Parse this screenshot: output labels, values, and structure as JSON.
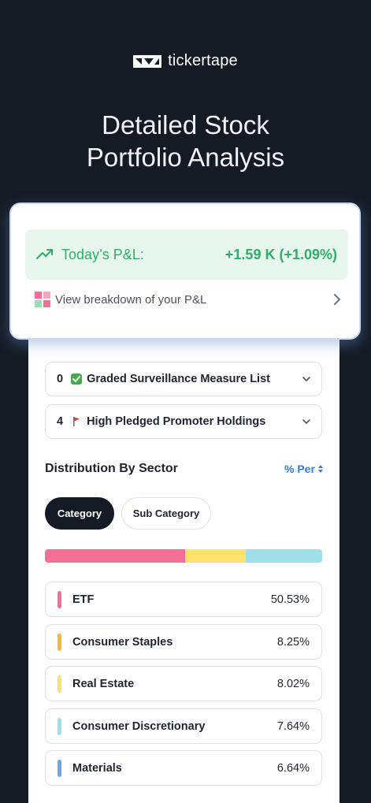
{
  "brand": {
    "name": "tickertape"
  },
  "hero": {
    "line1": "Detailed Stock",
    "line2": "Portfolio Analysis"
  },
  "pnl": {
    "label": "Today’s P&L:",
    "value": "+1.59 K (+1.09%)",
    "breakdown_label": "View breakdown of your P&L"
  },
  "alerts": [
    {
      "count": "0",
      "emoji": "check-mark-icon",
      "label": "Graded Surveillance Measure List"
    },
    {
      "count": "4",
      "emoji": "red-flag-icon",
      "label": "High Pledged Promoter Holdings"
    }
  ],
  "distribution": {
    "title": "Distribution By Sector",
    "toggle_label": "% Per",
    "tabs": [
      "Category",
      "Sub Category"
    ],
    "bar_segments": [
      {
        "share": 50.53,
        "color": "#f36f93"
      },
      {
        "share": 21.9,
        "color": "#fde36b"
      },
      {
        "share": 27.57,
        "color": "#9ee0ea"
      }
    ],
    "sectors": [
      {
        "name": "ETF",
        "pct": "50.53%",
        "color": "#f36f93"
      },
      {
        "name": "Consumer Staples",
        "pct": "8.25%",
        "color": "#f5b93a"
      },
      {
        "name": "Real Estate",
        "pct": "8.02%",
        "color": "#fde36b"
      },
      {
        "name": "Consumer Discretionary",
        "pct": "7.64%",
        "color": "#9ee0ea"
      },
      {
        "name": "Materials",
        "pct": "6.64%",
        "color": "#6aa6ea"
      }
    ]
  },
  "colors": {
    "background": "#151b25",
    "positive": "#2eae68",
    "accent": "#2f7fd6"
  }
}
